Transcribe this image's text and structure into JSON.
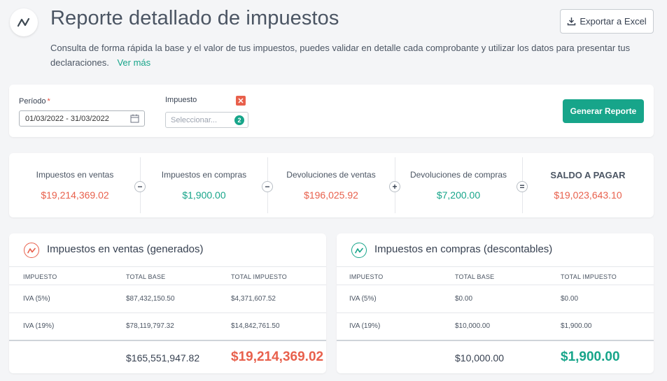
{
  "header": {
    "title": "Reporte detallado de impuestos",
    "description": "Consulta de forma rápida la base y el valor de tus impuestos, puedes validar en detalle cada comprobante y utilizar los datos para presentar tus declaraciones.",
    "more_link": "Ver más",
    "export_label": "Exportar a Excel"
  },
  "filters": {
    "period_label": "Período",
    "period_required": "*",
    "period_value": "01/03/2022 - 31/03/2022",
    "tax_label": "Impuesto",
    "tax_placeholder": "Seleccionar...",
    "tax_count": "2",
    "generate_label": "Generar Reporte"
  },
  "summary": {
    "items": [
      {
        "label": "Impuestos en ventas",
        "value": "$19,214,369.02"
      },
      {
        "label": "Impuestos en compras",
        "value": "$1,900.00"
      },
      {
        "label": "Devoluciones de ventas",
        "value": "$196,025.92"
      },
      {
        "label": "Devoluciones de compras",
        "value": "$7,200.00"
      },
      {
        "label": "SALDO A PAGAR",
        "value": "$19,023,643.10"
      }
    ],
    "operators": [
      "−",
      "−",
      "+",
      "="
    ]
  },
  "sales": {
    "title": "Impuestos en ventas (generados)",
    "headers": [
      "IMPUESTO",
      "TOTAL BASE",
      "TOTAL IMPUESTO"
    ],
    "rows": [
      {
        "tax": "IVA (5%)",
        "base": "$87,432,150.50",
        "total": "$4,371,607.52"
      },
      {
        "tax": "IVA (19%)",
        "base": "$78,119,797.32",
        "total": "$14,842,761.50"
      }
    ],
    "footer_base": "$165,551,947.82",
    "footer_total": "$19,214,369.02"
  },
  "purchases": {
    "title": "Impuestos en compras (descontables)",
    "headers": [
      "IMPUESTO",
      "TOTAL BASE",
      "TOTAL IMPUESTO"
    ],
    "rows": [
      {
        "tax": "IVA (5%)",
        "base": "$0.00",
        "total": "$0.00"
      },
      {
        "tax": "IVA (19%)",
        "base": "$10,000.00",
        "total": "$1,900.00"
      }
    ],
    "footer_base": "$10,000.00",
    "footer_total": "$1,900.00"
  },
  "colors": {
    "accent": "#17a58a",
    "negative": "#e8604c"
  },
  "icons": [
    "trend-logo-icon",
    "download-icon",
    "calendar-icon",
    "close-icon",
    "trend-red-icon",
    "trend-green-icon"
  ]
}
